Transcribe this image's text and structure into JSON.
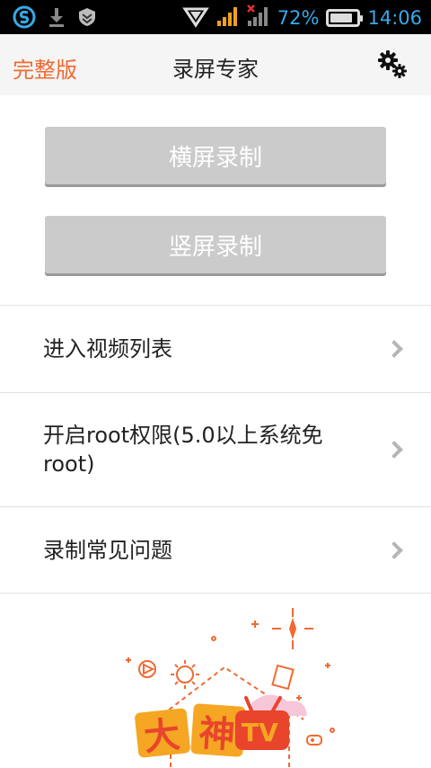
{
  "status_bar": {
    "battery": "72%",
    "time": "14:06",
    "icons": [
      "sogou-input-icon",
      "download-icon",
      "shield-icon",
      "triangle-signal-icon",
      "signal-bars-icon",
      "signal-bars-off-icon",
      "battery-icon"
    ]
  },
  "header": {
    "left_label": "完整版",
    "title": "录屏专家",
    "right_icon": "gears-icon"
  },
  "buttons": {
    "landscape": "横屏录制",
    "portrait": "竖屏录制"
  },
  "menu": [
    {
      "label": "进入视频列表"
    },
    {
      "label": "开启root权限(5.0以上系统免root)"
    },
    {
      "label": "录制常见问题"
    }
  ],
  "colors": {
    "accent": "#f06a32",
    "status_text": "#38a9e8",
    "button_bg": "#cbcbcb"
  }
}
